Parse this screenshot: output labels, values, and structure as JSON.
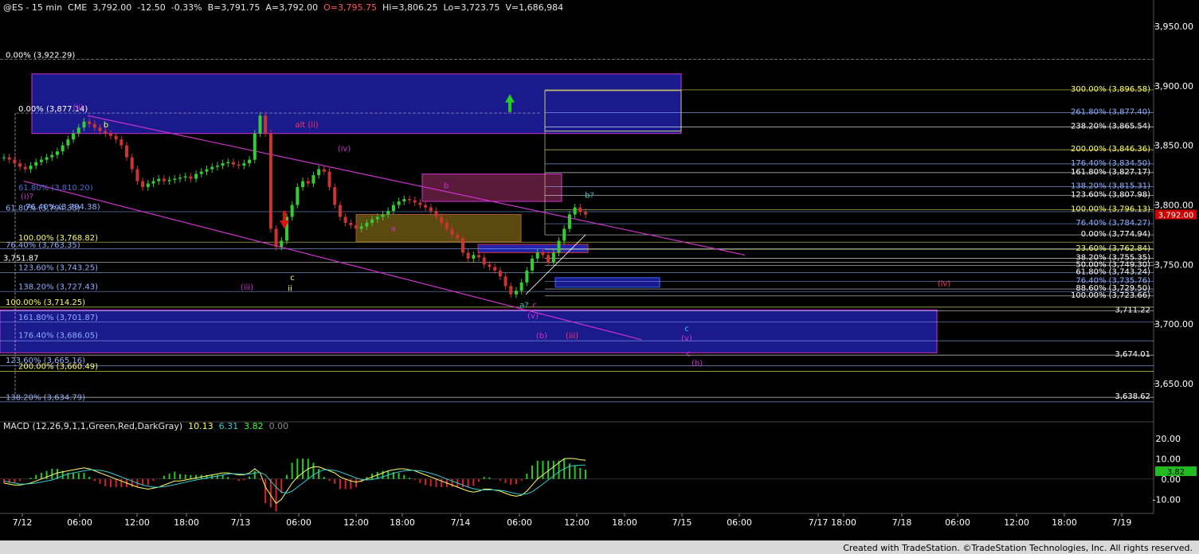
{
  "header": {
    "symbol": "@ES - 15 min",
    "exchange": "CME",
    "last": "3,792.00",
    "change": "-12.50",
    "change_pct": "-0.33%",
    "bid": "B=3,791.75",
    "ask": "A=3,792.00",
    "open": "O=3,795.75",
    "high": "Hi=3,806.25",
    "low": "Lo=3,723.75",
    "volume": "V=1,686,984"
  },
  "credit": "Created with TradeStation. ©TradeStation Technologies, Inc. All rights reserved.",
  "colors": {
    "background": "#000000",
    "price_axis_bg": "#000000",
    "channel": "#cc33cc",
    "box_blue": "#1a1a8c",
    "fib_yellow": "#e8e87a",
    "fib_cyan": "#8fb0ff",
    "up_arrow": "#22cc22",
    "down_arrow": "#dd1111",
    "last_price_bg": "#cc0000"
  },
  "price_axis": {
    "ticks": [
      "3,950.00",
      "3,900.00",
      "3,850.00",
      "3,800.00",
      "3,750.00",
      "3,700.00",
      "3,650.00"
    ],
    "last_price_label": "3,792.00"
  },
  "time_axis": {
    "ticks": [
      "7/12",
      "06:00",
      "12:00",
      "18:00",
      "7/13",
      "06:00",
      "12:00",
      "18:00",
      "7/14",
      "06:00",
      "12:00",
      "18:00",
      "7/15",
      "06:00",
      "7/17",
      "18:00",
      "7/18",
      "06:00",
      "12:00",
      "18:00",
      "7/19"
    ]
  },
  "fib_labels_left": [
    {
      "text": "0.00% (3,922.29)",
      "color": "#ffffff"
    },
    {
      "text": "0.00% (3,877.14)",
      "color": "#ffffff"
    },
    {
      "text": "61.80% (3,810.20)",
      "color": "#4a6bd6"
    },
    {
      "text": "76.40% (3,794.38)",
      "color": "#8fb0ff"
    },
    {
      "text": "61.80% (3,794.38)",
      "color": "#8fb0ff"
    },
    {
      "text": "100.00% (3,768.82)",
      "color": "#ffff66"
    },
    {
      "text": "76.40% (3,763.35)",
      "color": "#8fb0ff"
    },
    {
      "text": "3,751.87",
      "color": "#ffffff"
    },
    {
      "text": "123.60% (3,743.25)",
      "color": "#8fb0ff"
    },
    {
      "text": "138.20% (3,727.43)",
      "color": "#8fb0ff"
    },
    {
      "text": "100.00% (3,714.25)",
      "color": "#ffff66"
    },
    {
      "text": "161.80% (3,701.87)",
      "color": "#8fb0ff"
    },
    {
      "text": "176.40% (3,686.05)",
      "color": "#8fb0ff"
    },
    {
      "text": "123.60% (3,665.16)",
      "color": "#8fb0ff"
    },
    {
      "text": "200.00% (3,660.49)",
      "color": "#ffff66"
    },
    {
      "text": "138.20% (3,634.79)",
      "color": "#8fb0ff"
    }
  ],
  "fib_labels_right": [
    {
      "text": "300.00% (3,896.58)",
      "color": "#ffff66"
    },
    {
      "text": "261.80% (3,877.40)",
      "color": "#8fb0ff"
    },
    {
      "text": "238.20% (3,865.54)",
      "color": "#ffffff"
    },
    {
      "text": "200.00% (3,846.36)",
      "color": "#ffff66"
    },
    {
      "text": "176.40% (3,834.50)",
      "color": "#8fb0ff"
    },
    {
      "text": "161.80% (3,827.17)",
      "color": "#ffffff"
    },
    {
      "text": "138.20% (3,815.31)",
      "color": "#8fb0ff"
    },
    {
      "text": "123.60% (3,807.98)",
      "color": "#ffffff"
    },
    {
      "text": "100.00% (3,796.13)",
      "color": "#ffff66"
    },
    {
      "text": "76.40% (3,784.27)",
      "color": "#8fb0ff"
    },
    {
      "text": "0.00% (3,774.94)",
      "color": "#ffffff"
    },
    {
      "text": "23.60% (3,762.84)",
      "color": "#ffff66"
    },
    {
      "text": "38.20% (3,755.35)",
      "color": "#ffffff"
    },
    {
      "text": "50.00% (3,749.30)",
      "color": "#ffffff"
    },
    {
      "text": "61.80% (3,743.24)",
      "color": "#ffffff"
    },
    {
      "text": "76.40% (3,735.76)",
      "color": "#8fb0ff"
    },
    {
      "text": "88.60% (3,729.50)",
      "color": "#ffffff"
    },
    {
      "text": "100.00% (3,723.66)",
      "color": "#ffffff"
    },
    {
      "text": "3,711.22",
      "color": "#ffffff"
    },
    {
      "text": "3,674.01",
      "color": "#ffffff"
    },
    {
      "text": "3,638.62",
      "color": "#ffffff"
    }
  ],
  "wave_labels": [
    {
      "text": "(ii)",
      "color": "#cc33cc"
    },
    {
      "text": "b",
      "color": "#ffff66"
    },
    {
      "text": "alt (ii)",
      "color": "#ff3366"
    },
    {
      "text": "(iv)",
      "color": "#cc33cc"
    },
    {
      "text": "(i)?",
      "color": "#cc33cc"
    },
    {
      "text": "b",
      "color": "#cc33cc"
    },
    {
      "text": "b?",
      "color": "#33cccc"
    },
    {
      "text": "a",
      "color": "#cc33cc"
    },
    {
      "text": "c",
      "color": "#ffff66"
    },
    {
      "text": "ii",
      "color": "#ffff66"
    },
    {
      "text": "(iii)",
      "color": "#cc33cc"
    },
    {
      "text": "a?",
      "color": "#33cccc"
    },
    {
      "text": "c",
      "color": "#cc33cc"
    },
    {
      "text": "(v)",
      "color": "#cc33cc"
    },
    {
      "text": "(b)",
      "color": "#cc33cc"
    },
    {
      "text": "(iii)",
      "color": "#ff3366"
    },
    {
      "text": "c",
      "color": "#33cccc"
    },
    {
      "text": "(v)",
      "color": "#cc33cc"
    },
    {
      "text": "c",
      "color": "#cc33cc"
    },
    {
      "text": "(b)",
      "color": "#cc33cc"
    },
    {
      "text": "(iv)",
      "color": "#ff3366"
    }
  ],
  "macd": {
    "label": "MACD (12,26,9,1,1,Green,Red,DarkGray)",
    "values": [
      "10.13",
      "6.31",
      "3.82",
      "0.00"
    ],
    "value_colors": [
      "#ffff66",
      "#33cccc",
      "#33ff33",
      "#888888"
    ],
    "ticks": [
      "20.00",
      "10.00",
      "0.00",
      "-10.00"
    ],
    "last_label": "3.82"
  },
  "chart_data": {
    "type": "candlestick",
    "y_range": [
      3620,
      3960
    ],
    "macd_range": [
      -15,
      25
    ],
    "series": [
      {
        "name": "price",
        "values": [
          3840,
          3838,
          3835,
          3832,
          3830,
          3833,
          3836,
          3838,
          3840,
          3842,
          3845,
          3850,
          3855,
          3860,
          3865,
          3870,
          3868,
          3865,
          3862,
          3860,
          3858,
          3855,
          3850,
          3840,
          3830,
          3820,
          3815,
          3818,
          3820,
          3822,
          3820,
          3821,
          3822,
          3823,
          3824,
          3822,
          3826,
          3828,
          3830,
          3832,
          3833,
          3835,
          3836,
          3834,
          3833,
          3835,
          3838,
          3860,
          3875,
          3860,
          3780,
          3765,
          3770,
          3790,
          3800,
          3815,
          3820,
          3818,
          3825,
          3830,
          3828,
          3815,
          3800,
          3790,
          3785,
          3783,
          3780,
          3782,
          3785,
          3788,
          3790,
          3792,
          3795,
          3800,
          3803,
          3805,
          3804,
          3802,
          3800,
          3798,
          3795,
          3790,
          3785,
          3780,
          3775,
          3772,
          3760,
          3755,
          3758,
          3756,
          3750,
          3748,
          3745,
          3740,
          3732,
          3725,
          3728,
          3735,
          3745,
          3755,
          3760,
          3758,
          3752,
          3760,
          3770,
          3780,
          3792,
          3798,
          3794,
          3792
        ]
      },
      {
        "name": "macd",
        "values": [
          -2,
          -2.5,
          -3,
          -3,
          -2.5,
          -2,
          -1,
          0,
          1,
          2,
          3,
          3.5,
          4,
          4.5,
          5,
          5.5,
          5,
          4,
          3,
          2,
          1,
          0,
          -1,
          -2,
          -3,
          -4,
          -4.5,
          -5,
          -4.5,
          -4,
          -3,
          -2,
          -1,
          -1,
          -0.5,
          0,
          0.5,
          1,
          1.5,
          2,
          2.5,
          3,
          3,
          2.5,
          2,
          2,
          3,
          5,
          3,
          -4,
          -8,
          -12,
          -10,
          -6,
          -2,
          1,
          3,
          5,
          6,
          6,
          5,
          4,
          3,
          1,
          0,
          -1,
          -1.5,
          -1,
          0,
          1,
          2,
          3,
          4,
          4.5,
          5,
          5,
          4.5,
          4,
          3,
          2,
          1,
          0,
          -1,
          -2,
          -3,
          -4,
          -5,
          -6,
          -6.5,
          -6,
          -5,
          -5,
          -5.5,
          -6,
          -7,
          -8,
          -8.5,
          -8,
          -6,
          -3,
          0,
          2,
          4,
          6,
          8,
          10,
          10.13,
          10,
          9.5,
          9.2
        ]
      },
      {
        "name": "signal",
        "values": [
          -1,
          -1.5,
          -2,
          -2.5,
          -2.5,
          -2.3,
          -2,
          -1.5,
          -1,
          -0.5,
          0.5,
          1.5,
          2.5,
          3,
          3.5,
          4,
          4.5,
          4.5,
          4.2,
          3.8,
          3,
          2,
          1,
          0,
          -1,
          -2,
          -3,
          -3.5,
          -4,
          -4,
          -3.8,
          -3.3,
          -2.8,
          -2.2,
          -1.6,
          -1,
          -0.5,
          0,
          0.5,
          1,
          1.5,
          2,
          2.5,
          2.6,
          2.5,
          2.3,
          2.4,
          3,
          3.2,
          2,
          -1,
          -4,
          -6.5,
          -7,
          -6,
          -4,
          -2,
          0,
          2,
          3.5,
          4.5,
          4.5,
          4.2,
          3.5,
          2.5,
          1.5,
          0.5,
          -0.2,
          -0.5,
          -0.3,
          0.3,
          1,
          2,
          2.8,
          3.5,
          4,
          4.2,
          4.2,
          4,
          3.5,
          2.8,
          2,
          1,
          0,
          -1,
          -2,
          -3,
          -4,
          -4.8,
          -5.3,
          -5.5,
          -5.4,
          -5.4,
          -5.6,
          -6,
          -6.6,
          -7.2,
          -7.6,
          -7.3,
          -6.3,
          -4.5,
          -2.5,
          -0.5,
          1.5,
          3.5,
          5,
          6.31,
          6.6,
          6.8,
          6.9
        ]
      }
    ]
  }
}
